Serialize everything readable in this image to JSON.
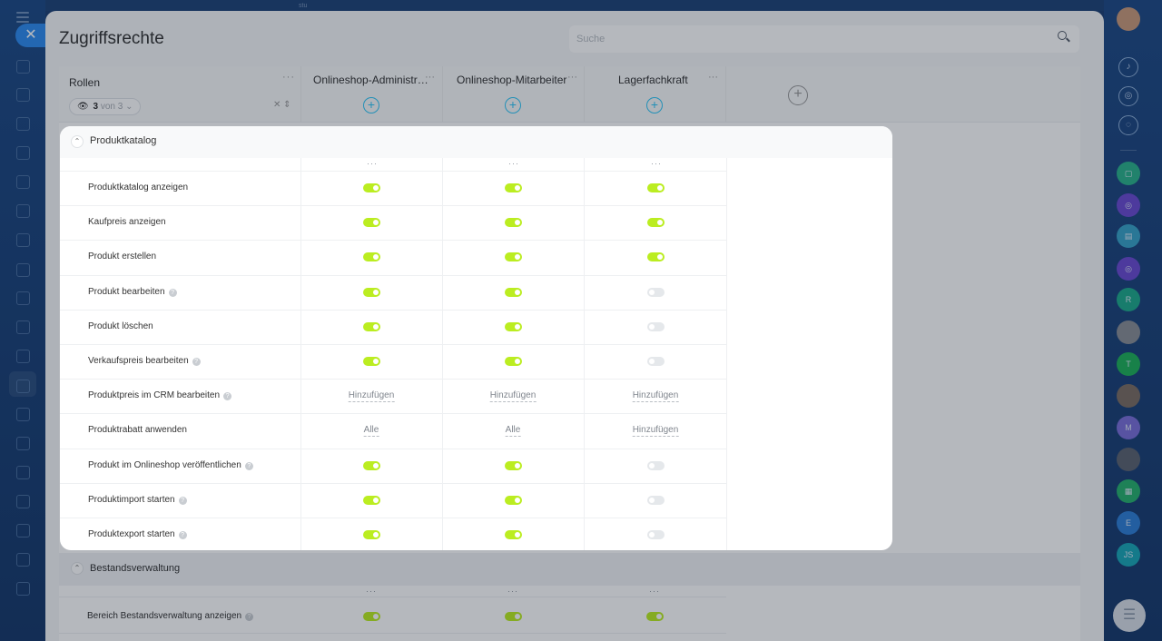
{
  "background": {
    "topbar_text": "stu",
    "right_sidebar": {
      "avatars": [
        "R",
        "T",
        "M",
        "E",
        "JS"
      ]
    }
  },
  "page": {
    "title": "Zugriffsrechte",
    "search_placeholder": "Suche"
  },
  "table": {
    "roles_header": "Rollen",
    "roles_filter": {
      "count": "3",
      "of_text": "von 3"
    },
    "columns": [
      "Onlineshop-Administr…",
      "Onlineshop-Mitarbeiter",
      "Lagerfachkraft"
    ],
    "add_column_symbol": "+",
    "column_add_symbol": "+",
    "more_symbol": "···"
  },
  "sections": [
    {
      "title": "Produktkatalog",
      "rows": [
        {
          "label": "Produktkatalog anzeigen",
          "help": false,
          "cells": [
            {
              "type": "toggle",
              "on": true
            },
            {
              "type": "toggle",
              "on": true
            },
            {
              "type": "toggle",
              "on": true
            }
          ]
        },
        {
          "label": "Kaufpreis anzeigen",
          "help": false,
          "cells": [
            {
              "type": "toggle",
              "on": true
            },
            {
              "type": "toggle",
              "on": true
            },
            {
              "type": "toggle",
              "on": true
            }
          ]
        },
        {
          "label": "Produkt erstellen",
          "help": false,
          "cells": [
            {
              "type": "toggle",
              "on": true
            },
            {
              "type": "toggle",
              "on": true
            },
            {
              "type": "toggle",
              "on": true
            }
          ]
        },
        {
          "label": "Produkt bearbeiten",
          "help": true,
          "cells": [
            {
              "type": "toggle",
              "on": true
            },
            {
              "type": "toggle",
              "on": true
            },
            {
              "type": "toggle",
              "on": false
            }
          ]
        },
        {
          "label": "Produkt löschen",
          "help": false,
          "cells": [
            {
              "type": "toggle",
              "on": true
            },
            {
              "type": "toggle",
              "on": true
            },
            {
              "type": "toggle",
              "on": false
            }
          ]
        },
        {
          "label": "Verkaufspreis bearbeiten",
          "help": true,
          "cells": [
            {
              "type": "toggle",
              "on": true
            },
            {
              "type": "toggle",
              "on": true
            },
            {
              "type": "toggle",
              "on": false
            }
          ]
        },
        {
          "label": "Produktpreis im CRM bearbeiten",
          "help": true,
          "cells": [
            {
              "type": "link",
              "text": "Hinzufügen"
            },
            {
              "type": "link",
              "text": "Hinzufügen"
            },
            {
              "type": "link",
              "text": "Hinzufügen"
            }
          ]
        },
        {
          "label": "Produktrabatt anwenden",
          "help": false,
          "cells": [
            {
              "type": "link",
              "text": "Alle"
            },
            {
              "type": "link",
              "text": "Alle"
            },
            {
              "type": "link",
              "text": "Hinzufügen"
            }
          ]
        },
        {
          "label": "Produkt im Onlineshop veröffentlichen",
          "help": true,
          "cells": [
            {
              "type": "toggle",
              "on": true
            },
            {
              "type": "toggle",
              "on": true
            },
            {
              "type": "toggle",
              "on": false
            }
          ]
        },
        {
          "label": "Produktimport starten",
          "help": true,
          "cells": [
            {
              "type": "toggle",
              "on": true
            },
            {
              "type": "toggle",
              "on": true
            },
            {
              "type": "toggle",
              "on": false
            }
          ]
        },
        {
          "label": "Produktexport starten",
          "help": true,
          "cells": [
            {
              "type": "toggle",
              "on": true
            },
            {
              "type": "toggle",
              "on": true
            },
            {
              "type": "toggle",
              "on": false
            }
          ]
        }
      ]
    },
    {
      "title": "Bestandsverwaltung",
      "rows": [
        {
          "label": "Bereich Bestandsverwaltung anzeigen",
          "help": true,
          "cells": [
            {
              "type": "toggle",
              "on": true
            },
            {
              "type": "toggle",
              "on": true
            },
            {
              "type": "toggle",
              "on": true
            }
          ]
        }
      ]
    }
  ],
  "colors": {
    "toggle_on": "#bbed21",
    "toggle_off": "#e5e8eb",
    "accent_plus": "#2fc6f6",
    "close_button": "#2f8bf0"
  }
}
